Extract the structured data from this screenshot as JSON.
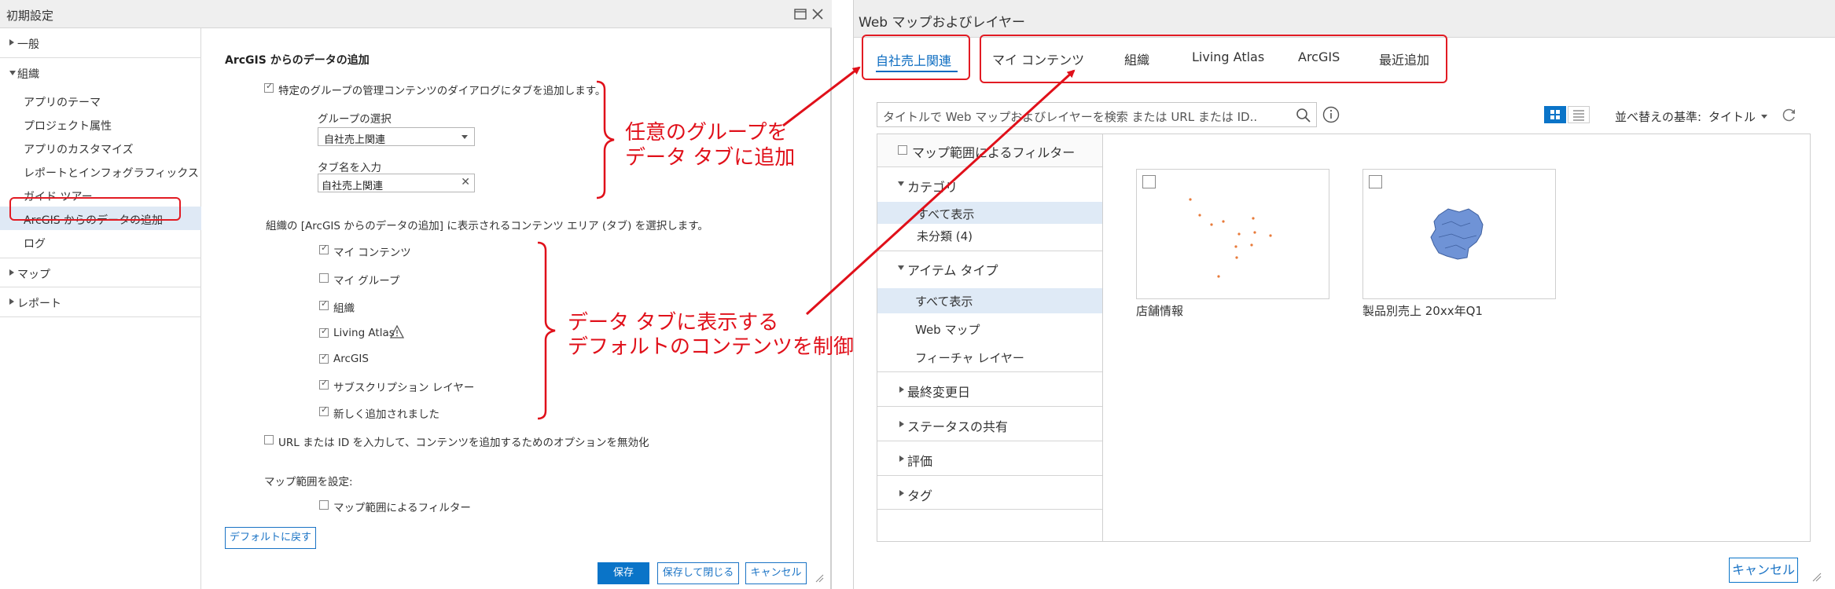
{
  "left_dialog": {
    "title": "初期設定",
    "nav": {
      "general": "一般",
      "organization": "組織",
      "org_items": [
        "アプリのテーマ",
        "プロジェクト属性",
        "アプリのカスタマイズ",
        "レポートとインフォグラフィックス",
        "ガイド ツアー",
        "ArcGIS からのデータの追加",
        "ログ"
      ],
      "map": "マップ",
      "report": "レポート"
    },
    "section_title": "ArcGIS からのデータの追加",
    "add_tab_checkbox": "特定のグループの管理コンテンツのダイアログにタブを追加します。",
    "group_select_label": "グループの選択",
    "group_select_value": "自社売上関連",
    "tab_name_label": "タブ名を入力",
    "tab_name_value": "自社売上関連",
    "content_area_text": "組織の [ArcGIS からのデータの追加] に表示されるコンテンツ エリア (タブ) を選択します。",
    "content_options": [
      {
        "label": "マイ コンテンツ",
        "checked": true
      },
      {
        "label": "マイ グループ",
        "checked": false
      },
      {
        "label": "組織",
        "checked": true
      },
      {
        "label": "Living Atlas",
        "checked": true
      },
      {
        "label": "ArcGIS",
        "checked": true
      },
      {
        "label": "サブスクリプション レイヤー",
        "checked": true
      },
      {
        "label": "新しく追加されました",
        "checked": true
      }
    ],
    "disable_url_option": "URL または ID を入力して、コンテンツを追加するためのオプションを無効化",
    "map_extent_label": "マップ範囲を設定:",
    "map_extent_filter": "マップ範囲によるフィルター",
    "reset_button": "デフォルトに戻す",
    "save_button": "保存",
    "save_close_button": "保存して閉じる",
    "cancel_button": "キャンセル"
  },
  "annotations": {
    "group_note_line1": "任意のグループを",
    "group_note_line2": "データ タブに追加",
    "default_note_line1": "データ タブに表示する",
    "default_note_line2": "デフォルトのコンテンツを制御"
  },
  "right_dialog": {
    "title": "Web マップおよびレイヤー",
    "tabs": [
      "自社売上関連",
      "マイ コンテンツ",
      "組織",
      "Living Atlas",
      "ArcGIS",
      "最近追加"
    ],
    "search_placeholder": "タイトルで Web マップおよびレイヤーを検索 または URL または ID..",
    "sort_label": "並べ替えの基準:",
    "sort_value": "タイトル",
    "filter_map_extent": "マップ範囲によるフィルター",
    "category_header": "カテゴリ",
    "category_items": [
      "すべて表示",
      "未分類 (4)"
    ],
    "item_type_header": "アイテム タイプ",
    "item_type_items": [
      "すべて表示",
      "Web マップ",
      "フィーチャ レイヤー"
    ],
    "last_modified": "最終変更日",
    "sharing_status": "ステータスの共有",
    "rating": "評価",
    "tags": "タグ",
    "results": [
      "店舗情報",
      "製品別売上 20xx年Q1"
    ],
    "cancel_button": "キャンセル"
  },
  "colors": {
    "accent_blue": "#0a74c8",
    "annotation_red": "#e0101a"
  }
}
